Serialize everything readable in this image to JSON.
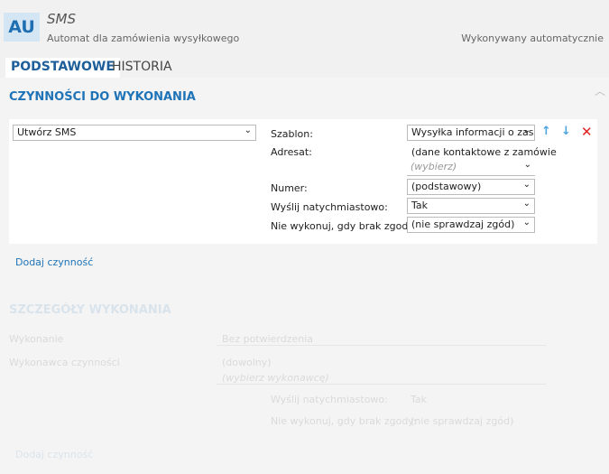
{
  "header": {
    "badge": "AU",
    "title": "SMS",
    "subtitle": "Automat dla zamówienia wysyłkowego",
    "exec_mode": "Wykonywany automatycznie"
  },
  "tabs": [
    {
      "label": "PODSTAWOWE",
      "active": true
    },
    {
      "label": "HISTORIA",
      "active": false
    }
  ],
  "actions": {
    "section_title": "CZYNNOŚCI DO WYKONANIA",
    "action_type": "Utwórz SMS",
    "fields": {
      "template_label": "Szablon:",
      "template_value": "Wysyłka informacji o zasa",
      "recipient_label": "Adresat:",
      "recipient_value": "(dane kontaktowe z zamówie",
      "recipient_pick": "(wybierz)",
      "number_label": "Numer:",
      "number_value": "(podstawowy)",
      "send_now_label": "Wyślij natychmiastowo:",
      "send_now_value": "Tak",
      "no_consent_label": "Nie wykonuj, gdy brak zgody:",
      "no_consent_value": "(nie sprawdzaj zgód)"
    },
    "add_link": "Dodaj czynność"
  },
  "details": {
    "section_title": "SZCZEGÓŁY WYKONANIA",
    "execution_label": "Wykonanie",
    "execution_value": "Bez potwierdzenia",
    "executor_label": "Wykonawca czynności",
    "executor_value": "(dowolny)",
    "executor_pick": "(wybierz wykonawcę)",
    "send_now_label": "Wyślij natychmiastowo:",
    "send_now_value": "Tak",
    "no_consent_label": "Nie wykonuj, gdy brak zgody:",
    "no_consent_value": "(nie sprawdzaj zgód)",
    "add_link": "Dodaj czynność"
  },
  "colors": {
    "accent": "#1f73b7",
    "delete": "#e02020",
    "arrow": "#4aa3e0"
  }
}
